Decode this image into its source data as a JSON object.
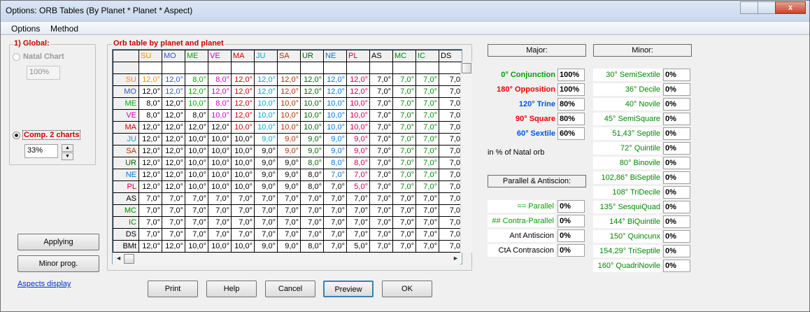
{
  "window": {
    "title": "Options: ORB Tables (By Planet * Planet * Aspect)",
    "close_glyph": "x"
  },
  "menu": [
    "Options",
    "Method"
  ],
  "global": {
    "legend": "1) Global:",
    "natal_label": "Natal Chart",
    "natal_value": "100%",
    "comp_label": "Comp. 2 charts",
    "comp_value": "33%"
  },
  "buttons": {
    "applying": "Applying",
    "minor_prog": "Minor prog.",
    "aspects_display": "Aspects display",
    "print": "Print",
    "help": "Help",
    "cancel": "Cancel",
    "preview": "Preview",
    "ok": "OK"
  },
  "grid": {
    "legend": "Orb table by planet and planet",
    "columns": [
      {
        "name": "SU",
        "color": "#ff8800"
      },
      {
        "name": "MO",
        "color": "#3355cc"
      },
      {
        "name": "ME",
        "color": "#00aa00"
      },
      {
        "name": "VE",
        "color": "#cc00cc"
      },
      {
        "name": "MA",
        "color": "#cc0000"
      },
      {
        "name": "JU",
        "color": "#00aacc"
      },
      {
        "name": "SA",
        "color": "#aa3300"
      },
      {
        "name": "UR",
        "color": "#006600"
      },
      {
        "name": "NE",
        "color": "#0077dd"
      },
      {
        "name": "PL",
        "color": "#cc0044"
      },
      {
        "name": "AS",
        "color": "#000000"
      },
      {
        "name": "MC",
        "color": "#008800"
      },
      {
        "name": "IC",
        "color": "#008800"
      },
      {
        "name": "DS",
        "color": "#000000"
      }
    ],
    "rows": [
      {
        "name": "SU",
        "color": "#ff8800",
        "cells": [
          "12,0°",
          "12,0°",
          "8,0°",
          "8,0°",
          "12,0°",
          "12,0°",
          "12,0°",
          "12,0°",
          "12,0°",
          "12,0°",
          "7,0°",
          "7,0°",
          "7,0°",
          "7,0"
        ]
      },
      {
        "name": "MO",
        "color": "#3355cc",
        "cells": [
          "12,0°",
          "12,0°",
          "12,0°",
          "12,0°",
          "12,0°",
          "12,0°",
          "12,0°",
          "12,0°",
          "12,0°",
          "12,0°",
          "7,0°",
          "7,0°",
          "7,0°",
          "7,0"
        ]
      },
      {
        "name": "ME",
        "color": "#00aa00",
        "cells": [
          "8,0°",
          "12,0°",
          "10,0°",
          "8,0°",
          "12,0°",
          "10,0°",
          "10,0°",
          "10,0°",
          "10,0°",
          "10,0°",
          "7,0°",
          "7,0°",
          "7,0°",
          "7,0"
        ]
      },
      {
        "name": "VE",
        "color": "#cc00cc",
        "cells": [
          "8,0°",
          "12,0°",
          "8,0°",
          "10,0°",
          "12,0°",
          "10,0°",
          "10,0°",
          "10,0°",
          "10,0°",
          "10,0°",
          "7,0°",
          "7,0°",
          "7,0°",
          "7,0"
        ]
      },
      {
        "name": "MA",
        "color": "#cc0000",
        "cells": [
          "12,0°",
          "12,0°",
          "12,0°",
          "12,0°",
          "10,0°",
          "10,0°",
          "10,0°",
          "10,0°",
          "10,0°",
          "10,0°",
          "7,0°",
          "7,0°",
          "7,0°",
          "7,0"
        ]
      },
      {
        "name": "JU",
        "color": "#00aacc",
        "cells": [
          "12,0°",
          "12,0°",
          "10,0°",
          "10,0°",
          "10,0°",
          "9,0°",
          "9,0°",
          "9,0°",
          "9,0°",
          "9,0°",
          "7,0°",
          "7,0°",
          "7,0°",
          "7,0"
        ]
      },
      {
        "name": "SA",
        "color": "#aa3300",
        "cells": [
          "12,0°",
          "12,0°",
          "10,0°",
          "10,0°",
          "10,0°",
          "9,0°",
          "9,0°",
          "9,0°",
          "9,0°",
          "9,0°",
          "7,0°",
          "7,0°",
          "7,0°",
          "7,0"
        ]
      },
      {
        "name": "UR",
        "color": "#006600",
        "cells": [
          "12,0°",
          "12,0°",
          "10,0°",
          "10,0°",
          "10,0°",
          "9,0°",
          "9,0°",
          "8,0°",
          "8,0°",
          "8,0°",
          "7,0°",
          "7,0°",
          "7,0°",
          "7,0"
        ]
      },
      {
        "name": "NE",
        "color": "#0077dd",
        "cells": [
          "12,0°",
          "12,0°",
          "10,0°",
          "10,0°",
          "10,0°",
          "9,0°",
          "9,0°",
          "8,0°",
          "7,0°",
          "7,0°",
          "7,0°",
          "7,0°",
          "7,0°",
          "7,0"
        ]
      },
      {
        "name": "PL",
        "color": "#cc0044",
        "cells": [
          "12,0°",
          "12,0°",
          "10,0°",
          "10,0°",
          "10,0°",
          "9,0°",
          "9,0°",
          "8,0°",
          "7,0°",
          "5,0°",
          "7,0°",
          "7,0°",
          "7,0°",
          "7,0"
        ]
      },
      {
        "name": "AS",
        "color": "#000000",
        "cells": [
          "7,0°",
          "7,0°",
          "7,0°",
          "7,0°",
          "7,0°",
          "7,0°",
          "7,0°",
          "7,0°",
          "7,0°",
          "7,0°",
          "7,0°",
          "7,0°",
          "7,0°",
          "7,0"
        ]
      },
      {
        "name": "MC",
        "color": "#008800",
        "cells": [
          "7,0°",
          "7,0°",
          "7,0°",
          "7,0°",
          "7,0°",
          "7,0°",
          "7,0°",
          "7,0°",
          "7,0°",
          "7,0°",
          "7,0°",
          "7,0°",
          "7,0°",
          "7,0"
        ]
      },
      {
        "name": "IC",
        "color": "#008800",
        "cells": [
          "7,0°",
          "7,0°",
          "7,0°",
          "7,0°",
          "7,0°",
          "7,0°",
          "7,0°",
          "7,0°",
          "7,0°",
          "7,0°",
          "7,0°",
          "7,0°",
          "7,0°",
          "7,0"
        ]
      },
      {
        "name": "DS",
        "color": "#000000",
        "cells": [
          "7,0°",
          "7,0°",
          "7,0°",
          "7,0°",
          "7,0°",
          "7,0°",
          "7,0°",
          "7,0°",
          "7,0°",
          "7,0°",
          "7,0°",
          "7,0°",
          "7,0°",
          "7,0"
        ]
      },
      {
        "name": "BMt",
        "color": "#000000",
        "cells": [
          "12,0°",
          "12,0°",
          "10,0°",
          "10,0°",
          "10,0°",
          "9,0°",
          "9,0°",
          "8,0°",
          "7,0°",
          "5,0°",
          "7,0°",
          "7,0°",
          "7,0°",
          "7,0"
        ]
      }
    ]
  },
  "major": {
    "header": "Major:",
    "items": [
      {
        "label": "0° Conjunction",
        "value": "100%",
        "color": "#00a000"
      },
      {
        "label": "180° Opposition",
        "value": "100%",
        "color": "#ee0000"
      },
      {
        "label": "120° Trine",
        "value": "80%",
        "color": "#0055dd"
      },
      {
        "label": "90° Square",
        "value": "80%",
        "color": "#ee0000"
      },
      {
        "label": "60° Sextile",
        "value": "60%",
        "color": "#0055dd"
      }
    ],
    "note": "in % of Natal orb"
  },
  "parallel": {
    "header": "Parallel & Antiscion:",
    "items": [
      {
        "label": "== Parallel",
        "value": "0%",
        "color": "#00a000"
      },
      {
        "label": "## Contra-Parallel",
        "value": "0%",
        "color": "#00a000"
      },
      {
        "label": "Ant Antiscion",
        "value": "0%",
        "color": "#000000"
      },
      {
        "label": "CtA Contrascion",
        "value": "0%",
        "color": "#000000"
      }
    ]
  },
  "minor": {
    "header": "Minor:",
    "items": [
      {
        "label": "30° SemiSextile",
        "value": "0%"
      },
      {
        "label": "36° Decile",
        "value": "0%"
      },
      {
        "label": "40° Novile",
        "value": "0%"
      },
      {
        "label": "45° SemiSquare",
        "value": "0%"
      },
      {
        "label": "51,43° Septile",
        "value": "0%"
      },
      {
        "label": "72° Quintile",
        "value": "0%"
      },
      {
        "label": "80° Binovile",
        "value": "0%"
      },
      {
        "label": "102,86° BiSeptile",
        "value": "0%"
      },
      {
        "label": "108° TriDecile",
        "value": "0%"
      },
      {
        "label": "135° SesquiQuad",
        "value": "0%"
      },
      {
        "label": "144° BiQuintile",
        "value": "0%"
      },
      {
        "label": "150° Quincunx",
        "value": "0%"
      },
      {
        "label": "154,29° TriSeptile",
        "value": "0%"
      },
      {
        "label": "160° QuadriNovile",
        "value": "0%"
      }
    ]
  }
}
